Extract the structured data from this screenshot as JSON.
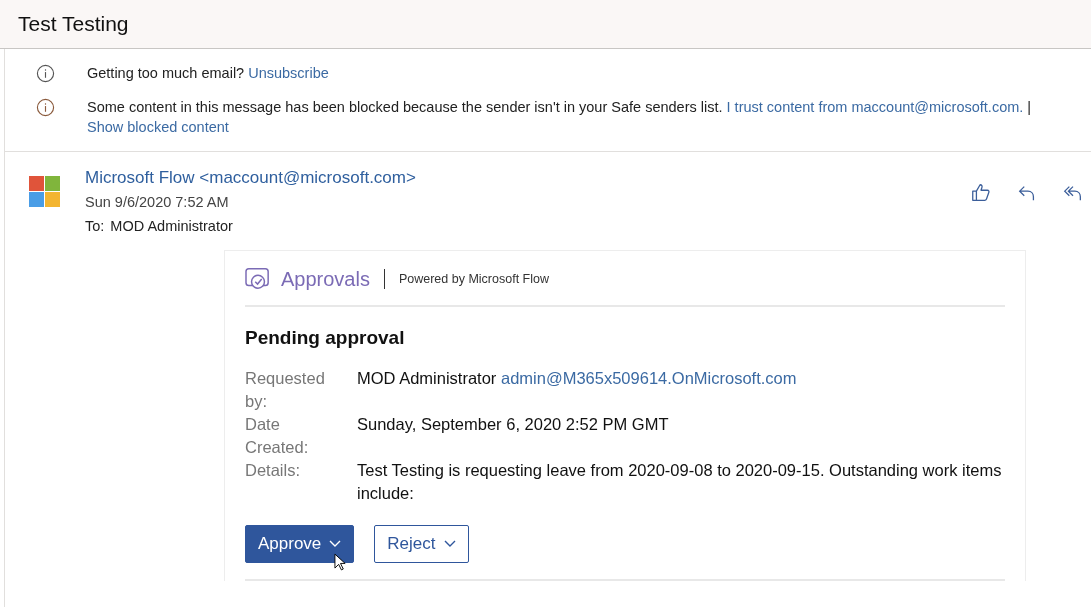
{
  "window": {
    "title": "Test Testing"
  },
  "notices": [
    {
      "kind": "info",
      "text": "Getting too much email?",
      "links": [
        {
          "text": "Unsubscribe",
          "newline": false
        }
      ]
    },
    {
      "kind": "warning",
      "text": "Some content in this message has been blocked because the sender isn't in your Safe senders list.",
      "links": [
        {
          "text": "I trust content from maccount@microsoft.com.",
          "newline": false
        },
        {
          "text": "Show blocked content",
          "newline": true
        }
      ],
      "separator": "|"
    }
  ],
  "message": {
    "sender": "Microsoft Flow <maccount@microsoft.com>",
    "date": "Sun 9/6/2020 7:52 AM",
    "to_label": "To:",
    "to": "MOD Administrator"
  },
  "card": {
    "brand": "Approvals",
    "powered_by": "Powered by Microsoft Flow",
    "heading": "Pending approval",
    "fields": [
      {
        "label": "Requested by:",
        "value": "MOD Administrator",
        "link": "admin@M365x509614.OnMicrosoft.com"
      },
      {
        "label": "Date Created:",
        "value": "Sunday, September 6, 2020 2:52 PM GMT"
      },
      {
        "label": "Details:",
        "value": "Test Testing is requesting leave from 2020-09-08 to 2020-09-15. Outstanding work items include:"
      }
    ],
    "buttons": [
      {
        "label": "Approve",
        "kind": "primary"
      },
      {
        "label": "Reject",
        "kind": "secondary"
      }
    ]
  }
}
